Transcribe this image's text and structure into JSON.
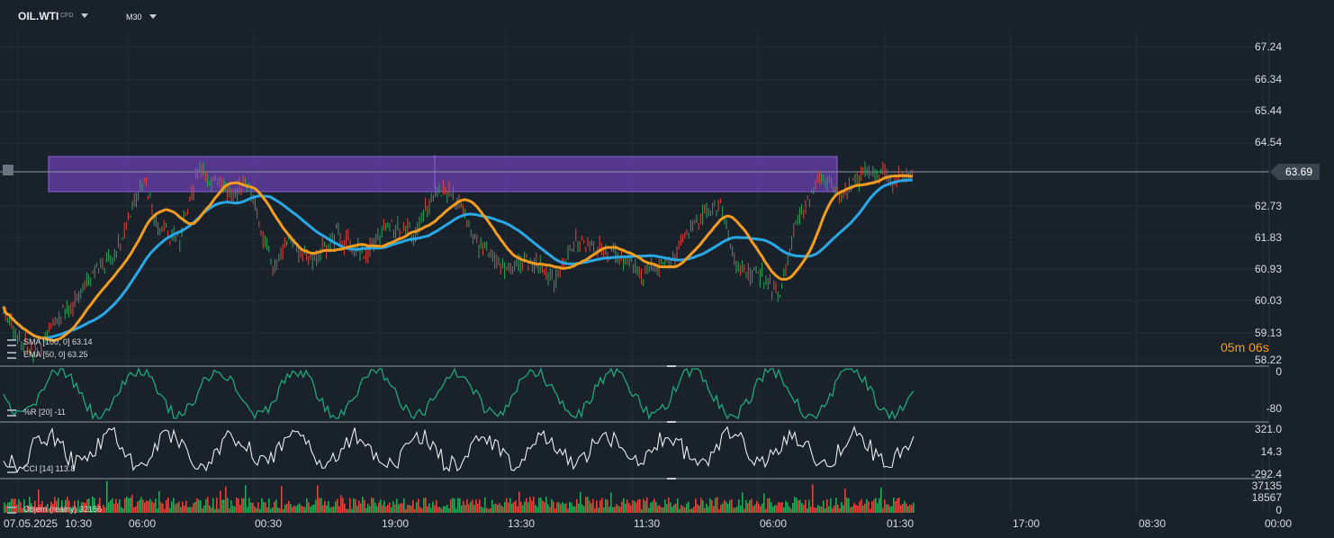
{
  "header": {
    "symbol": "OIL.WTI",
    "instrument_type": "CFD",
    "timeframe": "M30"
  },
  "price_axis": [
    "67.24",
    "66.34",
    "65.44",
    "64.54",
    "63.69",
    "62.73",
    "61.83",
    "60.93",
    "60.03",
    "59.13",
    "58.22"
  ],
  "current_price": "63.69",
  "countdown": "05m 06s",
  "time_axis": {
    "start_date": "07.05.2025",
    "labels": [
      "10:30",
      "06:00",
      "00:30",
      "19:00",
      "13:30",
      "11:30",
      "06:00",
      "01:30",
      "17:00",
      "08:30",
      "00:00"
    ]
  },
  "indicators": {
    "sma": "SMA [100, 0] 63.14",
    "ema": "EMA [50, 0] 63.25",
    "williams_r": "%R [20] -11",
    "cci": "CCI [14] 113.8",
    "volume": "Objem (reálný) 32156"
  },
  "wr_axis": [
    "0",
    "-80"
  ],
  "cci_axis": [
    "321.0",
    "14.3",
    "-292.4"
  ],
  "volume_axis": [
    "37135",
    "18567",
    "0"
  ],
  "colors": {
    "background": "#19222a",
    "ema": "#f39c1f",
    "sma": "#29a8e8",
    "zone": "#6a3fb0",
    "up": "#26a65b",
    "down": "#e0443e",
    "wr": "#1fa67a",
    "cci": "#e8ecef"
  },
  "icons": [
    "dropdown-chevron-icon",
    "indicator-settings-icon",
    "drawing-handle-icon"
  ]
}
